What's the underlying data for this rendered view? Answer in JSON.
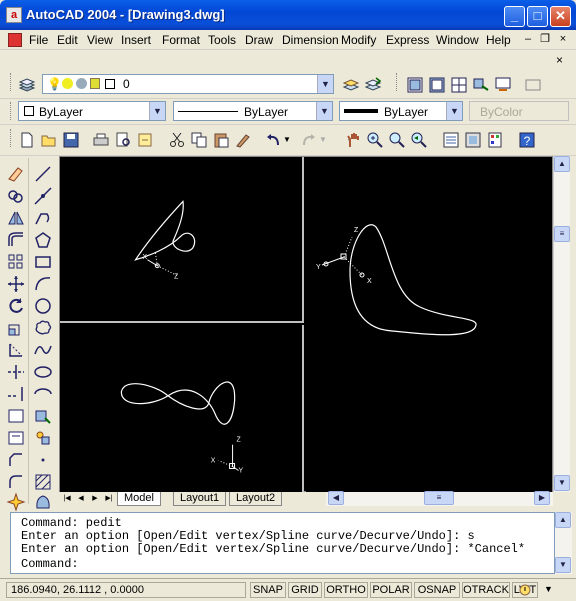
{
  "window": {
    "title": "AutoCAD 2004 - [Drawing3.dwg]",
    "app_icon_letter": "a",
    "controls": {
      "minimize": "_",
      "maximize": "□",
      "close": "✕"
    }
  },
  "menu": {
    "items": [
      "File",
      "Edit",
      "View",
      "Insert",
      "Format",
      "Tools",
      "Draw",
      "Dimension",
      "Modify",
      "Express",
      "Window",
      "Help"
    ],
    "doc_controls": {
      "minimize": "–",
      "restore": "❐",
      "close": "×"
    }
  },
  "layers": {
    "current_layer": "0"
  },
  "properties": {
    "color": "ByLayer",
    "linetype": "ByLayer",
    "lineweight": "ByLayer",
    "plotstyle": "ByColor"
  },
  "tabs": {
    "model": "Model",
    "layout1": "Layout1",
    "layout2": "Layout2"
  },
  "command": {
    "lines": [
      "Command: pedit",
      "Enter an option [Open/Edit vertex/Spline curve/Decurve/Undo]: s",
      "Enter an option [Open/Edit vertex/Spline curve/Decurve/Undo]: *Cancel*"
    ],
    "prompt": "Command:"
  },
  "status": {
    "coordinates": "186.0940, 26.1112 , 0.0000",
    "toggles": [
      "SNAP",
      "GRID",
      "ORTHO",
      "POLAR",
      "OSNAP",
      "OTRACK",
      "LWT"
    ]
  },
  "colors": {
    "title_blue": "#0a5fe8",
    "canvas": "#000000",
    "curve": "#ffffff",
    "viewport_border": "#c0c0c0"
  }
}
